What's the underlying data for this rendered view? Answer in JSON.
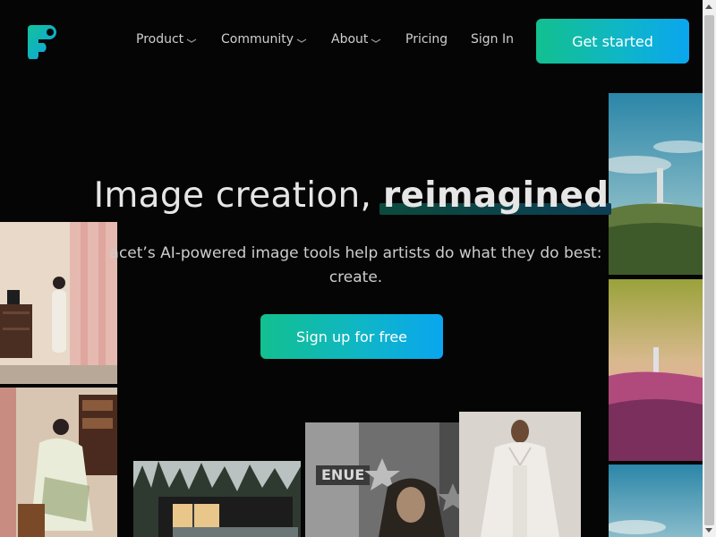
{
  "header": {
    "logo_icon": "facet-logo-icon",
    "nav": [
      {
        "label": "Product",
        "has_dropdown": true
      },
      {
        "label": "Community",
        "has_dropdown": true
      },
      {
        "label": "About",
        "has_dropdown": true
      },
      {
        "label": "Pricing",
        "has_dropdown": false
      },
      {
        "label": "Sign In",
        "has_dropdown": false
      }
    ],
    "cta_label": "Get started"
  },
  "hero": {
    "headline_plain": "Image creation, ",
    "headline_highlight": "reimagined",
    "subtext": "acet’s AI-powered image tools help artists do what they do best: create.",
    "cta_label": "Sign up for free"
  },
  "colors": {
    "background": "#050505",
    "accent_start": "#12c08f",
    "accent_end": "#0aa6ef"
  }
}
